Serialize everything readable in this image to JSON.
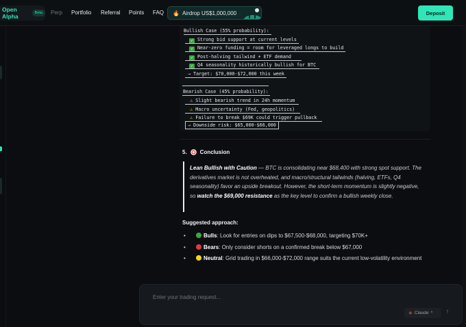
{
  "nav": {
    "brand": "Open Alpha",
    "beta": "Beta",
    "links": [
      "Perp",
      "Portfolio",
      "Referral",
      "Points",
      "FAQ"
    ],
    "airdrop": "Airdrop US$1,000,000",
    "deposit": "Deposit"
  },
  "analysis": {
    "bull_header": "Bullish Case (55% probability):",
    "bull_items": [
      "Strong bid support at current levels",
      "Near-zero funding = room for leveraged longs to build",
      "Post-halving tailwind + ETF demand",
      "Q4 seasonality historically bullish for BTC"
    ],
    "bull_target": "→ Target: $70,000-$72,000 this week",
    "bear_header": "Bearish Case (45% probability):",
    "bear_items": [
      "Slight bearish trend in 24h momentum",
      "Macro uncertainty (Fed, geopolitics)",
      "Failure to break $69K could trigger pullback"
    ],
    "bear_target": "→ Downside risk: $65,000-$66,000"
  },
  "conclusion": {
    "number": "5.",
    "title": "Conclusion",
    "quote_lead": "Lean Bullish with Caution",
    "quote_body_1": " — BTC is consolidating near $68,400 with strong spot support. The derivatives market is not overheated, and macro/structural tailwinds (halving, ETFs, Q4 seasonality) favor an upside breakout. However, the short-term momentum is slightly negative, so ",
    "quote_bold_2": "watch the $69,000 resistance",
    "quote_body_2": " as the key level to confirm a bullish weekly close."
  },
  "approach": {
    "heading": "Suggested approach:",
    "items": [
      {
        "label": "Bulls",
        "text": ": Look for entries on dips to $67,500-$68,000, targeting $70K+",
        "color": "#3aa845"
      },
      {
        "label": "Bears",
        "text": ": Only consider shorts on a confirmed break below $67,000",
        "color": "#e03a3a"
      },
      {
        "label": "Neutral",
        "text": ": Grid trading in $66,000-$72,000 range suits the current low-volatility environment",
        "color": "#f5d418"
      }
    ]
  },
  "input": {
    "placeholder": "Enter your trading request...",
    "model": "Claude"
  }
}
